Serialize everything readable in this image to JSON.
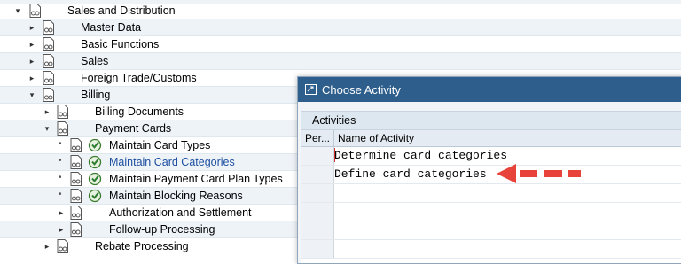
{
  "tree": {
    "items": [
      {
        "label": "Sales and Distribution"
      },
      {
        "label": "Master Data"
      },
      {
        "label": "Basic Functions"
      },
      {
        "label": "Sales"
      },
      {
        "label": "Foreign Trade/Customs"
      },
      {
        "label": "Billing"
      },
      {
        "label": "Billing Documents"
      },
      {
        "label": "Payment Cards"
      },
      {
        "label": "Maintain Card Types"
      },
      {
        "label": "Maintain Card Categories"
      },
      {
        "label": "Maintain Payment Card Plan Types"
      },
      {
        "label": "Maintain Blocking Reasons"
      },
      {
        "label": "Authorization and Settlement"
      },
      {
        "label": "Follow-up Processing"
      },
      {
        "label": "Rebate Processing"
      }
    ]
  },
  "dialog": {
    "title": "Choose Activity",
    "group_label": "Activities",
    "columns": [
      "Per...",
      "Name of Activity"
    ],
    "rows": [
      {
        "name": "Determine card categories"
      },
      {
        "name": "Define card categories"
      }
    ]
  },
  "colors": {
    "title_bar": "#2e5e8c",
    "selected_text": "#1d4fa0",
    "annotation_arrow": "#e8433a"
  },
  "icons": {
    "folder": "doc-glasses-icon",
    "activity": "execute-clock-icon"
  }
}
